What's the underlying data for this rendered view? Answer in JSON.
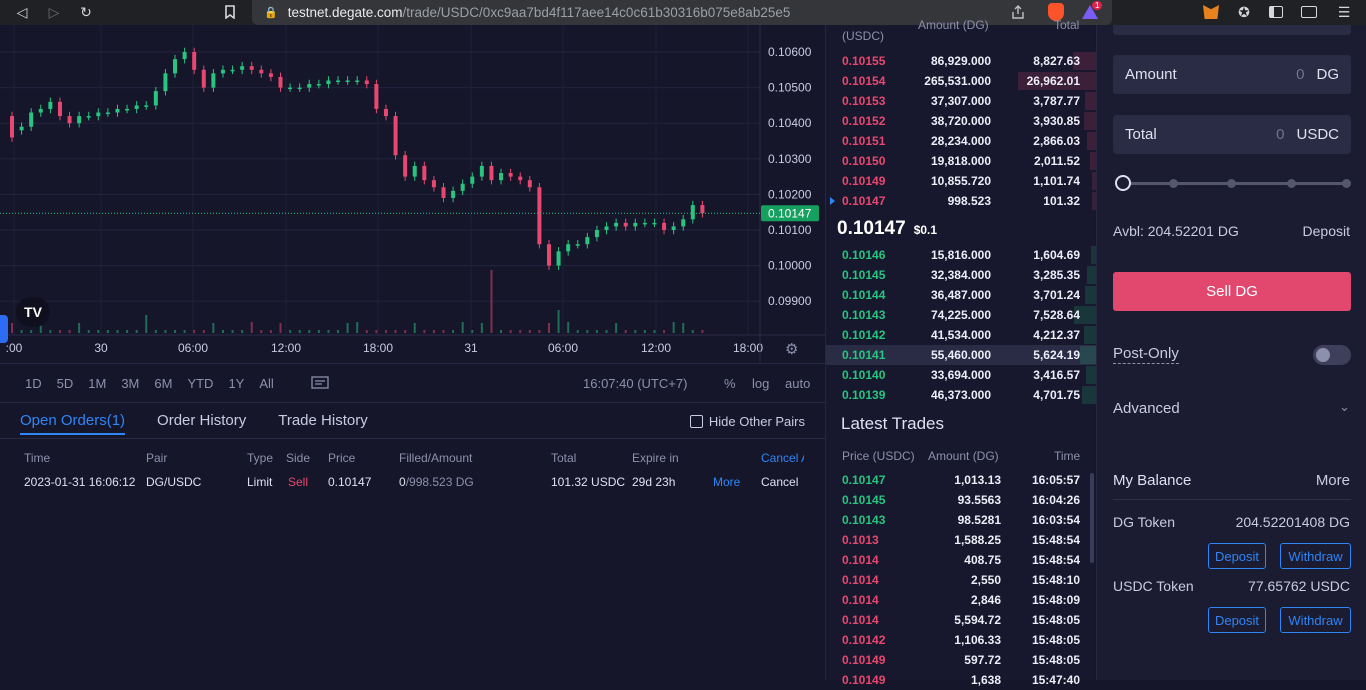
{
  "browser": {
    "url_host": "testnet.degate.com",
    "url_path": "/trade/USDC/0xc9aa7bd4f117aee14c0c61b30316b075e8ab25e5",
    "badge_count": "1"
  },
  "chart": {
    "price_ticks": [
      "0.10600",
      "0.10500",
      "0.10400",
      "0.10300",
      "0.10200",
      "0.10100",
      "0.10000",
      "0.09900"
    ],
    "current_price": "0.10147",
    "time_ticks": [
      ":00",
      "30",
      "06:00",
      "12:00",
      "18:00",
      "31",
      "06:00",
      "12:00",
      "18:00"
    ],
    "candles": [
      [
        0.1042,
        0.1036
      ],
      [
        0.1038,
        0.1039
      ],
      [
        0.1039,
        0.1043
      ],
      [
        0.1043,
        0.1044
      ],
      [
        0.1044,
        0.1046
      ],
      [
        0.1046,
        0.1042
      ],
      [
        0.1042,
        0.104
      ],
      [
        0.104,
        0.1042
      ],
      [
        0.1042,
        0.1042
      ],
      [
        0.1042,
        0.1043
      ],
      [
        0.1043,
        0.1043
      ],
      [
        0.1043,
        0.1044
      ],
      [
        0.1044,
        0.1044
      ],
      [
        0.1044,
        0.1045
      ],
      [
        0.1045,
        0.1045
      ],
      [
        0.1045,
        0.1049
      ],
      [
        0.1049,
        0.1054
      ],
      [
        0.1054,
        0.1058
      ],
      [
        0.1058,
        0.106
      ],
      [
        0.106,
        0.1055
      ],
      [
        0.1055,
        0.105
      ],
      [
        0.105,
        0.1054
      ],
      [
        0.1054,
        0.1055
      ],
      [
        0.1055,
        0.1055
      ],
      [
        0.1055,
        0.1056
      ],
      [
        0.1056,
        0.1055
      ],
      [
        0.1055,
        0.1054
      ],
      [
        0.1054,
        0.1053
      ],
      [
        0.1053,
        0.105
      ],
      [
        0.105,
        0.105
      ],
      [
        0.105,
        0.105
      ],
      [
        0.105,
        0.1051
      ],
      [
        0.1051,
        0.1051
      ],
      [
        0.1051,
        0.1052
      ],
      [
        0.1052,
        0.1052
      ],
      [
        0.1052,
        0.1052
      ],
      [
        0.1052,
        0.1052
      ],
      [
        0.1052,
        0.1051
      ],
      [
        0.1051,
        0.1044
      ],
      [
        0.1044,
        0.1042
      ],
      [
        0.1042,
        0.1031
      ],
      [
        0.1031,
        0.1025
      ],
      [
        0.1025,
        0.1028
      ],
      [
        0.1028,
        0.1024
      ],
      [
        0.1024,
        0.1022
      ],
      [
        0.1022,
        0.1019
      ],
      [
        0.1019,
        0.1021
      ],
      [
        0.1021,
        0.1023
      ],
      [
        0.1023,
        0.1025
      ],
      [
        0.1025,
        0.1028
      ],
      [
        0.1028,
        0.1024
      ],
      [
        0.1024,
        0.1026
      ],
      [
        0.1026,
        0.1025
      ],
      [
        0.1025,
        0.1024
      ],
      [
        0.1024,
        0.1022
      ],
      [
        0.1022,
        0.1006
      ],
      [
        0.1006,
        0.1
      ],
      [
        0.1,
        0.1004
      ],
      [
        0.1004,
        0.1006
      ],
      [
        0.1006,
        0.1006
      ],
      [
        0.1006,
        0.1008
      ],
      [
        0.1008,
        0.101
      ],
      [
        0.101,
        0.1011
      ],
      [
        0.1011,
        0.1012
      ],
      [
        0.1012,
        0.1011
      ],
      [
        0.1011,
        0.1012
      ],
      [
        0.1012,
        0.1012
      ],
      [
        0.1012,
        0.1012
      ],
      [
        0.1012,
        0.101
      ],
      [
        0.101,
        0.1011
      ],
      [
        0.1011,
        0.1013
      ],
      [
        0.1013,
        0.1017
      ],
      [
        0.1017,
        0.10147
      ]
    ]
  },
  "timebar": {
    "ranges": [
      "1D",
      "5D",
      "1M",
      "3M",
      "6M",
      "YTD",
      "1Y",
      "All"
    ],
    "clock": "16:07:40 (UTC+7)",
    "opts": [
      "%",
      "log",
      "auto"
    ]
  },
  "orders": {
    "tabs": [
      "Open Orders(1)",
      "Order History",
      "Trade History"
    ],
    "hide_other": "Hide Other Pairs",
    "headers": [
      "Time",
      "Pair",
      "Type",
      "Side",
      "Price",
      "Filled/Amount",
      "Total",
      "Expire in",
      "Cancel A"
    ],
    "row": {
      "time": "2023-01-31 16:06:12",
      "pair": "DG/USDC",
      "type": "Limit",
      "side": "Sell",
      "price": "0.10147",
      "filled": "0",
      "amount": "/998.523 DG",
      "total": "101.32 USDC",
      "expire": "29d 23h",
      "more": "More",
      "cancel": "Cancel"
    }
  },
  "book": {
    "head_price": "(USDC)",
    "head_amount": "Amount (DG)",
    "head_total": "Total",
    "asks": [
      {
        "price": "0.10155",
        "amount": "86,929.000",
        "total": "8,827.63",
        "depth": 0.3
      },
      {
        "price": "0.10154",
        "amount": "265,531.000",
        "total": "26,962.01",
        "depth": 1.0
      },
      {
        "price": "0.10153",
        "amount": "37,307.000",
        "total": "3,787.77",
        "depth": 0.14
      },
      {
        "price": "0.10152",
        "amount": "38,720.000",
        "total": "3,930.85",
        "depth": 0.15
      },
      {
        "price": "0.10151",
        "amount": "28,234.000",
        "total": "2,866.03",
        "depth": 0.11
      },
      {
        "price": "0.10150",
        "amount": "19,818.000",
        "total": "2,011.52",
        "depth": 0.08
      },
      {
        "price": "0.10149",
        "amount": "10,855.720",
        "total": "1,101.74",
        "depth": 0.04
      },
      {
        "price": "0.10147",
        "amount": "998.523",
        "total": "101.32",
        "depth": 0.01
      }
    ],
    "mid_price": "0.10147",
    "mid_usd": "$0.1",
    "bids": [
      {
        "price": "0.10146",
        "amount": "15,816.000",
        "total": "1,604.69",
        "depth": 0.06
      },
      {
        "price": "0.10145",
        "amount": "32,384.000",
        "total": "3,285.35",
        "depth": 0.12
      },
      {
        "price": "0.10144",
        "amount": "36,487.000",
        "total": "3,701.24",
        "depth": 0.14
      },
      {
        "price": "0.10143",
        "amount": "74,225.000",
        "total": "7,528.64",
        "depth": 0.28
      },
      {
        "price": "0.10142",
        "amount": "41,534.000",
        "total": "4,212.37",
        "depth": 0.16
      },
      {
        "price": "0.10141",
        "amount": "55,460.000",
        "total": "5,624.19",
        "depth": 0.21
      },
      {
        "price": "0.10140",
        "amount": "33,694.000",
        "total": "3,416.57",
        "depth": 0.13
      },
      {
        "price": "0.10139",
        "amount": "46,373.000",
        "total": "4,701.75",
        "depth": 0.18
      }
    ],
    "latest_title": "Latest Trades",
    "lt_head_price": "Price (USDC)",
    "lt_head_amount": "Amount (DG)",
    "lt_head_time": "Time",
    "trades": [
      {
        "price": "0.10147",
        "side": "buy",
        "amount": "1,013.13",
        "time": "16:05:57"
      },
      {
        "price": "0.10145",
        "side": "buy",
        "amount": "93.5563",
        "time": "16:04:26"
      },
      {
        "price": "0.10143",
        "side": "buy",
        "amount": "98.5281",
        "time": "16:03:54"
      },
      {
        "price": "0.1013",
        "side": "sell",
        "amount": "1,588.25",
        "time": "15:48:54"
      },
      {
        "price": "0.1014",
        "side": "sell",
        "amount": "408.75",
        "time": "15:48:54"
      },
      {
        "price": "0.1014",
        "side": "sell",
        "amount": "2,550",
        "time": "15:48:10"
      },
      {
        "price": "0.1014",
        "side": "sell",
        "amount": "2,846",
        "time": "15:48:09"
      },
      {
        "price": "0.1014",
        "side": "sell",
        "amount": "5,594.72",
        "time": "15:48:05"
      },
      {
        "price": "0.10142",
        "side": "sell",
        "amount": "1,106.33",
        "time": "15:48:05"
      },
      {
        "price": "0.10149",
        "side": "sell",
        "amount": "597.72",
        "time": "15:48:05"
      },
      {
        "price": "0.10149",
        "side": "sell",
        "amount": "1,638",
        "time": "15:47:40"
      }
    ]
  },
  "panel": {
    "amount_label": "Amount",
    "amount_value": "0",
    "amount_unit": "DG",
    "total_label": "Total",
    "total_value": "0",
    "total_unit": "USDC",
    "avbl": "Avbl: 204.52201 DG",
    "deposit": "Deposit",
    "sell_btn": "Sell DG",
    "post_only": "Post-Only",
    "advanced": "Advanced",
    "balance_title": "My Balance",
    "balance_more": "More",
    "dg_label": "DG Token",
    "dg_value": "204.52201408 DG",
    "usdc_label": "USDC Token",
    "usdc_value": "77.65762 USDC",
    "deposit_btn": "Deposit",
    "withdraw_btn": "Withdraw"
  }
}
